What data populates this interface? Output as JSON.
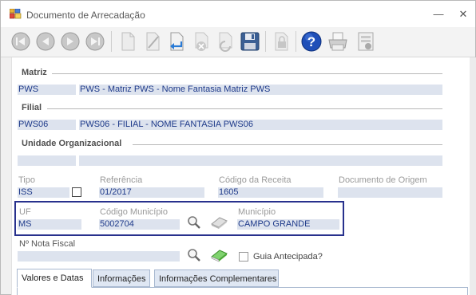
{
  "window": {
    "title": "Documento de Arrecadação",
    "minimize_glyph": "—",
    "close_glyph": "✕"
  },
  "toolbar": {
    "buttons": [
      "first-record-icon",
      "previous-record-icon",
      "next-record-icon",
      "last-record-icon",
      "new-document-icon",
      "edit-icon",
      "undo-icon",
      "delete-icon",
      "refresh-icon",
      "save-icon",
      "lock-icon",
      "help-icon",
      "print-icon",
      "report-icon"
    ]
  },
  "matriz": {
    "label": "Matriz",
    "code": "PWS",
    "name": "PWS - Matriz PWS - Nome Fantasia Matriz PWS"
  },
  "filial": {
    "label": "Filial",
    "code": "PWS06",
    "name": "PWS06 - FILIAL - NOME FANTASIA PWS06"
  },
  "unidade": {
    "label": "Unidade Organizacional",
    "code": "",
    "name": ""
  },
  "row1": {
    "tipo_label": "Tipo",
    "tipo_value": "ISS",
    "referencia_label": "Referência",
    "referencia_value": "01/2017",
    "codigo_receita_label": "Código da Receita",
    "codigo_receita_value": "1605",
    "documento_origem_label": "Documento de Origem",
    "documento_origem_value": ""
  },
  "row2": {
    "uf_label": "UF",
    "uf_value": "MS",
    "codigo_municipio_label": "Código Município",
    "codigo_municipio_value": "5002704",
    "municipio_label": "Município",
    "municipio_value": "CAMPO GRANDE"
  },
  "row3": {
    "nota_fiscal_label": "Nº Nota Fiscal",
    "nota_fiscal_value": "",
    "guia_antecipada_label": "Guia Antecipada?"
  },
  "tabs": [
    {
      "label": "Valores e Datas",
      "active": true
    },
    {
      "label": "Informações",
      "active": false
    },
    {
      "label": "Informações Complementares",
      "active": false
    }
  ],
  "colors": {
    "field_background": "#dde3ee",
    "field_text": "#1e3a8a",
    "highlight_border": "#28318d"
  }
}
